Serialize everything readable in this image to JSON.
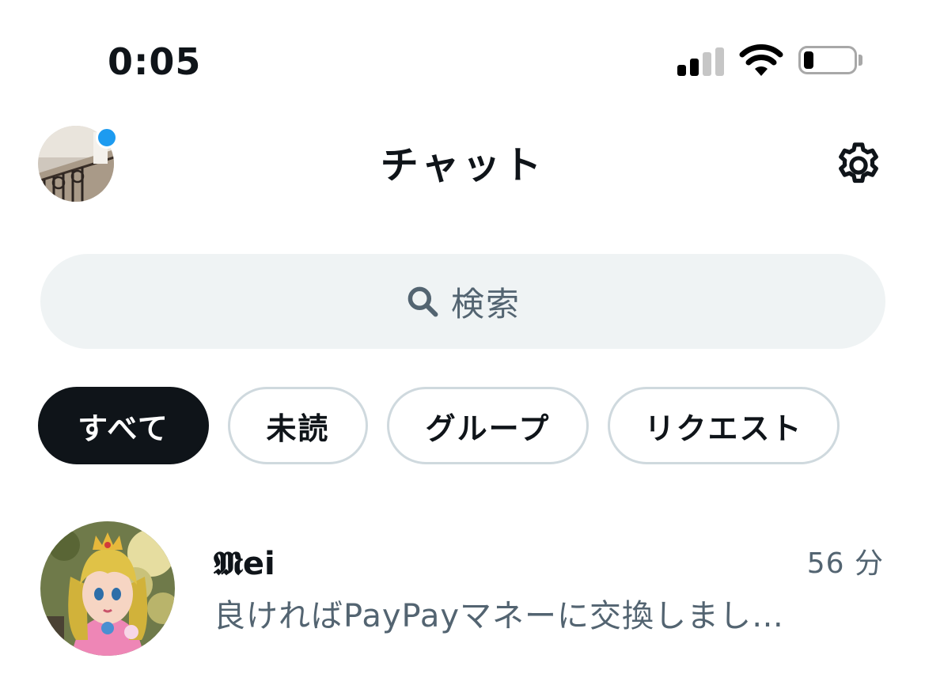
{
  "status_bar": {
    "time": "0:05",
    "icons": [
      "signal-icon",
      "wifi-icon",
      "battery-icon"
    ],
    "battery_level": 0.2
  },
  "header": {
    "title": "チャット",
    "unread_dot_color": "#1d9bf0"
  },
  "search": {
    "placeholder": "検索"
  },
  "filters": [
    {
      "label": "すべて",
      "active": true
    },
    {
      "label": "未読",
      "active": false
    },
    {
      "label": "グループ",
      "active": false
    },
    {
      "label": "リクエスト",
      "active": false
    }
  ],
  "conversations": [
    {
      "name": "𝕸ei",
      "time": "56 分",
      "preview": "良ければPayPayマネーに交換しまし…"
    }
  ],
  "colors": {
    "text_primary": "#0f1419",
    "text_secondary": "#536471",
    "accent": "#1d9bf0",
    "search_bg": "#eff3f4",
    "chip_border": "#cfd9de"
  }
}
